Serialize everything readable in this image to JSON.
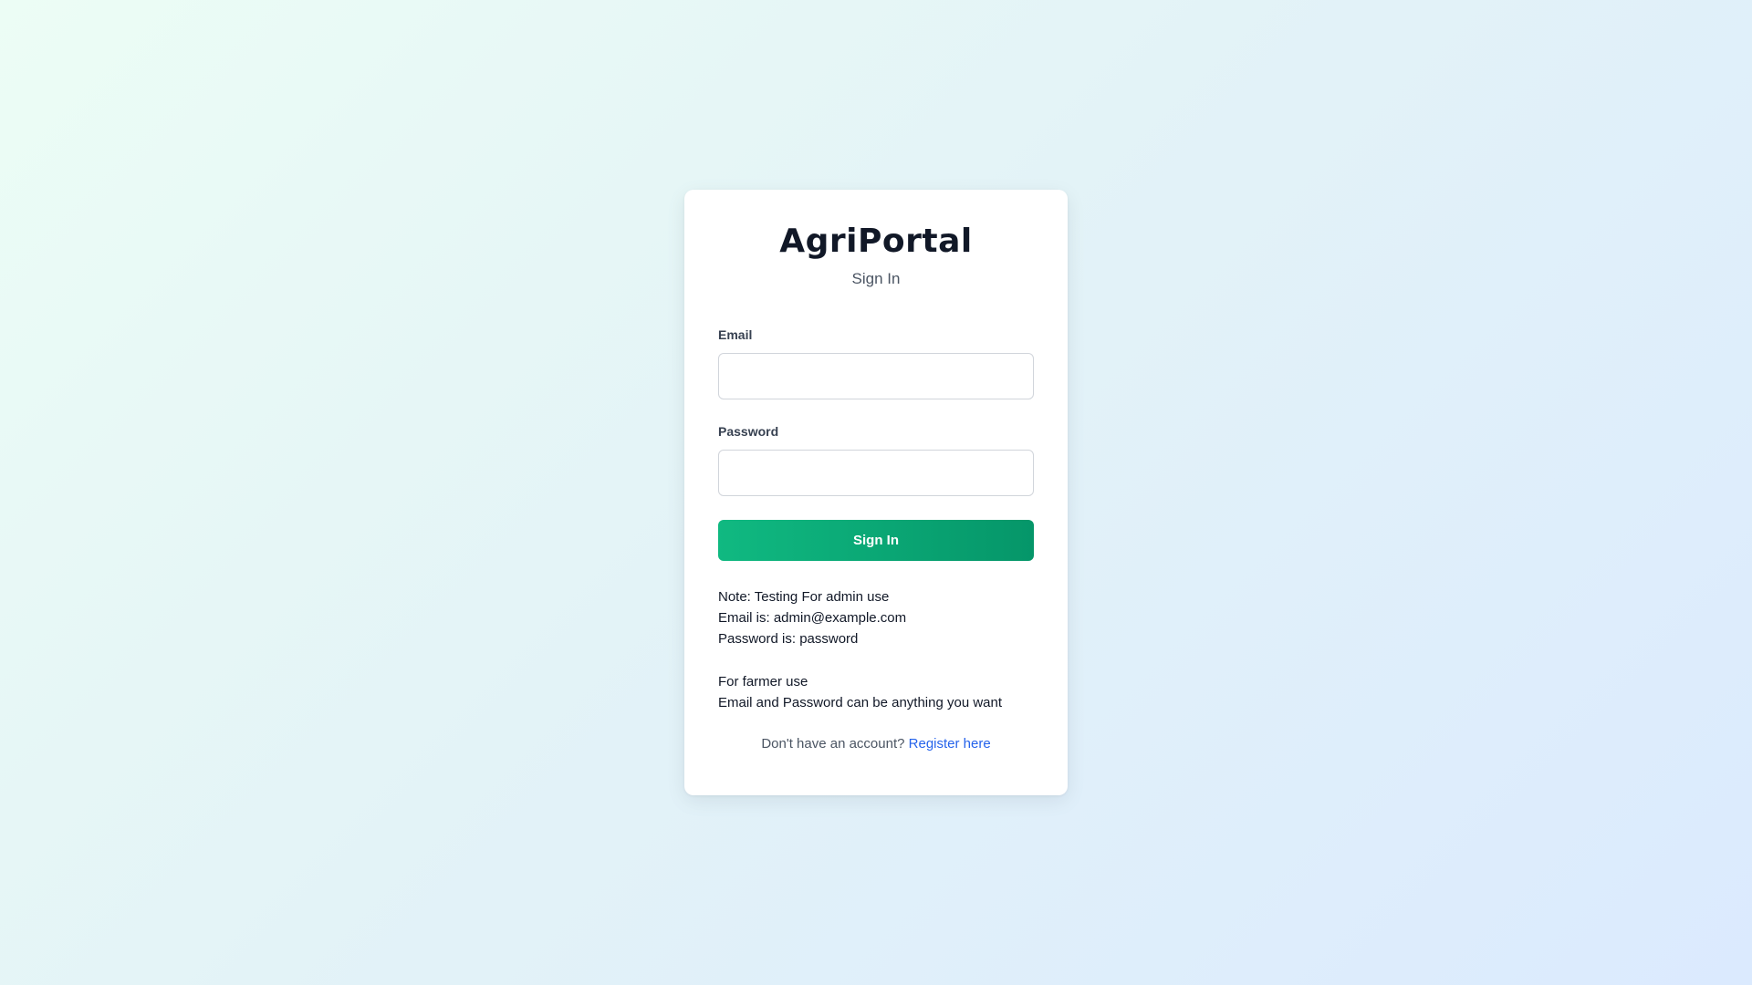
{
  "app": {
    "brand": "AgriPortal",
    "subtitle": "Sign In"
  },
  "form": {
    "email_label": "Email",
    "email_value": "",
    "email_placeholder": "",
    "password_label": "Password",
    "password_value": "",
    "password_placeholder": "",
    "submit_label": "Sign In"
  },
  "notes": {
    "admin": [
      "Note: Testing For admin use",
      "Email is: admin@example.com",
      "Password is: password"
    ],
    "farmer": [
      "For farmer use",
      "Email and Password can be anything you want"
    ]
  },
  "footer": {
    "prompt": "Don't have an account?",
    "link_label": "Register here"
  },
  "colors": {
    "accent_start": "#10b981",
    "accent_end": "#059669",
    "link": "#2563eb"
  }
}
